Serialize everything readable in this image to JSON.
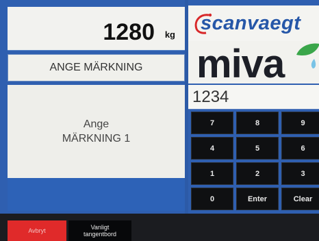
{
  "weight": {
    "value": "1280",
    "unit": "kg"
  },
  "label_field": {
    "text": "ANGE MÄRKNING"
  },
  "prompt": {
    "line1": "Ange",
    "line2": "MÄRKNING 1"
  },
  "brand": {
    "name": "scanvaegt",
    "product": "miva"
  },
  "entry": {
    "value": "1234"
  },
  "keypad": {
    "keys": [
      "7",
      "8",
      "9",
      "4",
      "5",
      "6",
      "1",
      "2",
      "3",
      "0",
      "Enter",
      "Clear"
    ]
  },
  "buttons": {
    "abort_label": "Avbryt",
    "keyboard_line1": "Vanligt",
    "keyboard_line2": "tangentbord"
  },
  "colors": {
    "background_blue": "#2f5fb0",
    "abort_red": "#e02a2a",
    "key_black": "#0f1012",
    "brand_blue": "#2657a8",
    "leaf_green": "#3aa64a"
  }
}
